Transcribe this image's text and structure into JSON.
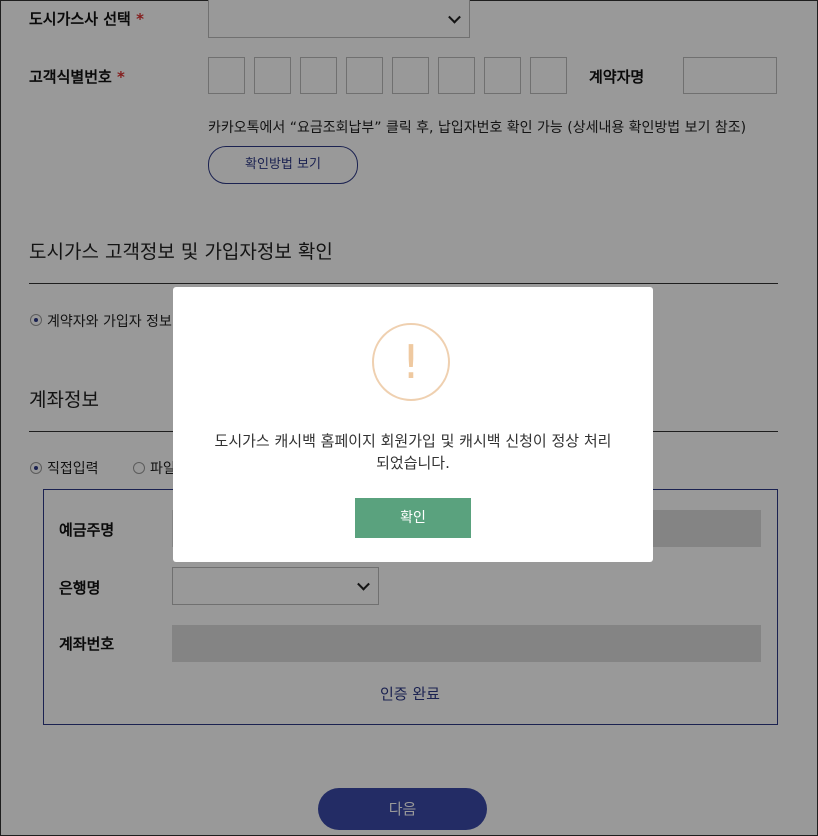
{
  "form": {
    "gas_company_label": "도시가스사 선택",
    "required_mark": "*",
    "customer_id_label": "고객식별번호",
    "contractor_name_label": "계약자명",
    "note": "카카오톡에서 “요금조회납부” 클릭 후, 납입자번호 확인 가능 (상세내용 확인방법 보기 참조)",
    "how_to_button": "확인방법 보기"
  },
  "section_customer": {
    "title": "도시가스 고객정보 및 가입자정보 확인",
    "radio_label": "계약자와 가입자 정보"
  },
  "section_account": {
    "title": "계좌정보",
    "radio_direct": "직접입력",
    "radio_file": "파일",
    "holder_label": "예금주명",
    "bank_label": "은행명",
    "account_label": "계좌번호",
    "verify_link": "인증 완료"
  },
  "next_button": "다음",
  "modal": {
    "icon": "exclamation-icon",
    "icon_glyph": "!",
    "message_line1": "도시가스 캐시백 홈페이지 회원가입 및 캐시백 신청이 정상 처리",
    "message_line2": "되었습니다.",
    "ok_button": "확인"
  },
  "colors": {
    "accent": "#2e3a87",
    "confirm": "#5aa27e",
    "required": "#d33333",
    "icon_ring": "#efd0b0"
  }
}
